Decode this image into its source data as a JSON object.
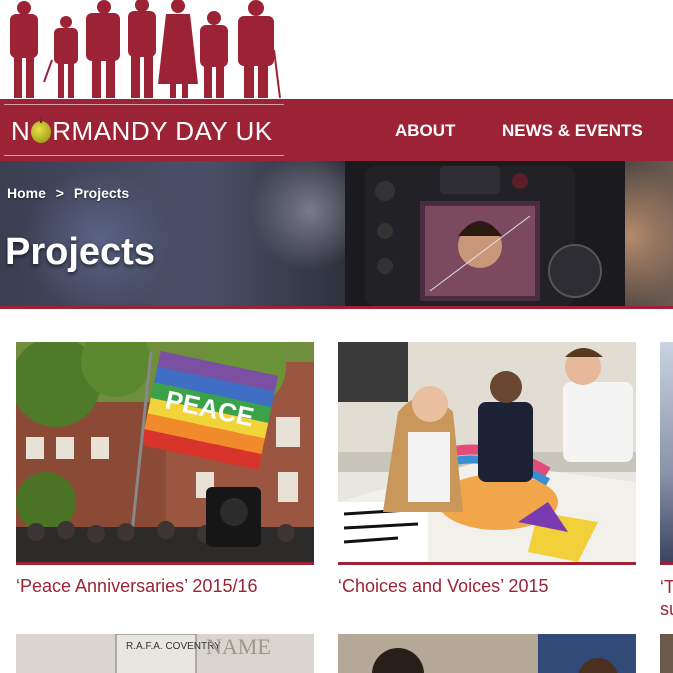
{
  "brand": {
    "logo_text_pre": "N",
    "logo_text_post": "RMANDY DAY UK",
    "accent": "#9b2335"
  },
  "nav": {
    "items": [
      {
        "label": "ABOUT"
      },
      {
        "label": "NEWS & EVENTS"
      }
    ]
  },
  "breadcrumb": {
    "home": "Home",
    "separator": ">",
    "current": "Projects"
  },
  "page": {
    "title": "Projects"
  },
  "projects": [
    {
      "title": "‘Peace Anniversaries’ 2015/16"
    },
    {
      "title": "‘Choices and Voices’ 2015"
    },
    {
      "title_line1": "‘T",
      "title_line2": "su"
    }
  ],
  "row2": {
    "plaque_text": "R.A.F.A. COVENTRY",
    "engraved_text": "NAME"
  }
}
